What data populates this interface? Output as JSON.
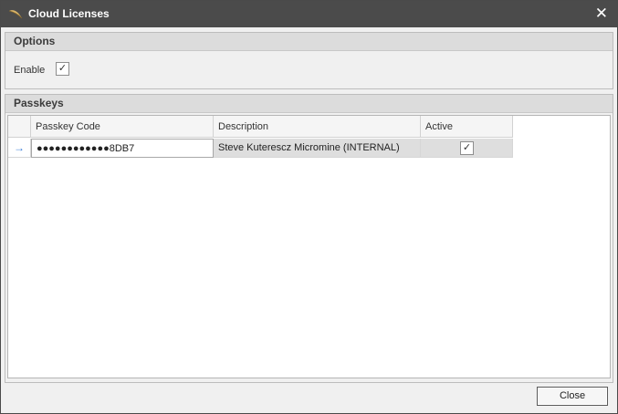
{
  "window": {
    "title": "Cloud Licenses",
    "icon": "feather-icon",
    "close_glyph": "✕"
  },
  "options": {
    "header": "Options",
    "enable_label": "Enable",
    "enable_checked": "✓"
  },
  "passkeys": {
    "header": "Passkeys",
    "columns": [
      "Passkey Code",
      "Description",
      "Active"
    ],
    "rows": [
      {
        "indicator": "→",
        "code": "●●●●●●●●●●●●8DB7",
        "description": "Steve Kuterescz Micromine (INTERNAL)",
        "active": "✓"
      }
    ]
  },
  "footer": {
    "close_label": "Close"
  }
}
